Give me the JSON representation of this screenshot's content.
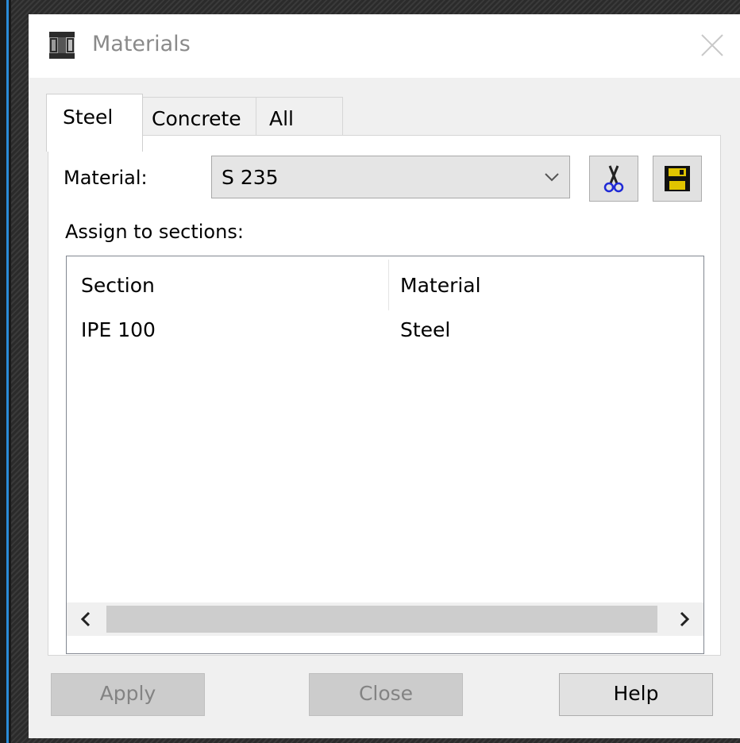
{
  "window": {
    "title": "Materials"
  },
  "tabs": [
    {
      "label": "Steel",
      "active": true
    },
    {
      "label": "Concrete",
      "active": false
    },
    {
      "label": "All",
      "active": false
    }
  ],
  "material": {
    "label": "Material:",
    "selected": "S 235",
    "cut_icon": "scissors-icon",
    "save_icon": "floppy-disk-icon"
  },
  "assign": {
    "label": "Assign to sections:",
    "columns": [
      "Section",
      "Material"
    ],
    "rows": [
      {
        "section": "IPE 100",
        "material": "Steel"
      }
    ]
  },
  "buttons": {
    "apply": "Apply",
    "close": "Close",
    "help": "Help"
  }
}
